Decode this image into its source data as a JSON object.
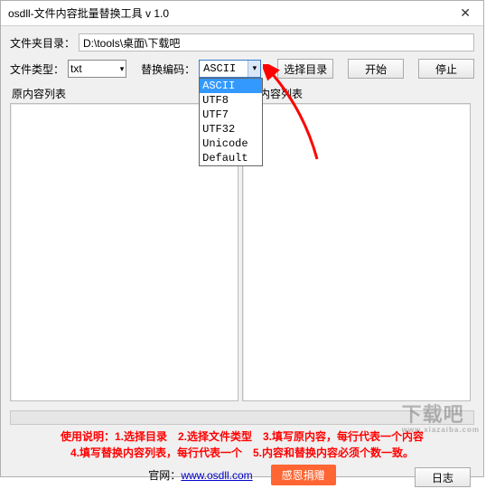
{
  "window": {
    "title": "osdll-文件内容批量替换工具 v 1.0"
  },
  "labels": {
    "folder_dir": "文件夹目录：",
    "file_type": "文件类型：",
    "encoding": "替换编码：",
    "orig_list": "原内容列表",
    "repl_list": "换内容列表"
  },
  "inputs": {
    "folder_path": "D:\\tools\\桌面\\下载吧",
    "file_type_value": "txt",
    "encoding_value": "ASCII"
  },
  "encoding_options": [
    "ASCII",
    "UTF8",
    "UTF7",
    "UTF32",
    "Unicode",
    "Default"
  ],
  "buttons": {
    "select_dir": "选择目录",
    "start": "开始",
    "stop": "停止",
    "donate": "感恩捐赠",
    "log": "日志"
  },
  "instructions": {
    "line1": "使用说明：1.选择目录　2.选择文件类型　3.填写原内容，每行代表一个内容",
    "line2": "4.填写替换内容列表，每行代表一个　5.内容和替换内容必须个数一致。"
  },
  "footer": {
    "site_label": "官网：",
    "site_url": "www.osdll.com"
  },
  "watermark": {
    "main": "下载吧",
    "sub": "www.xiazaiba.com"
  }
}
